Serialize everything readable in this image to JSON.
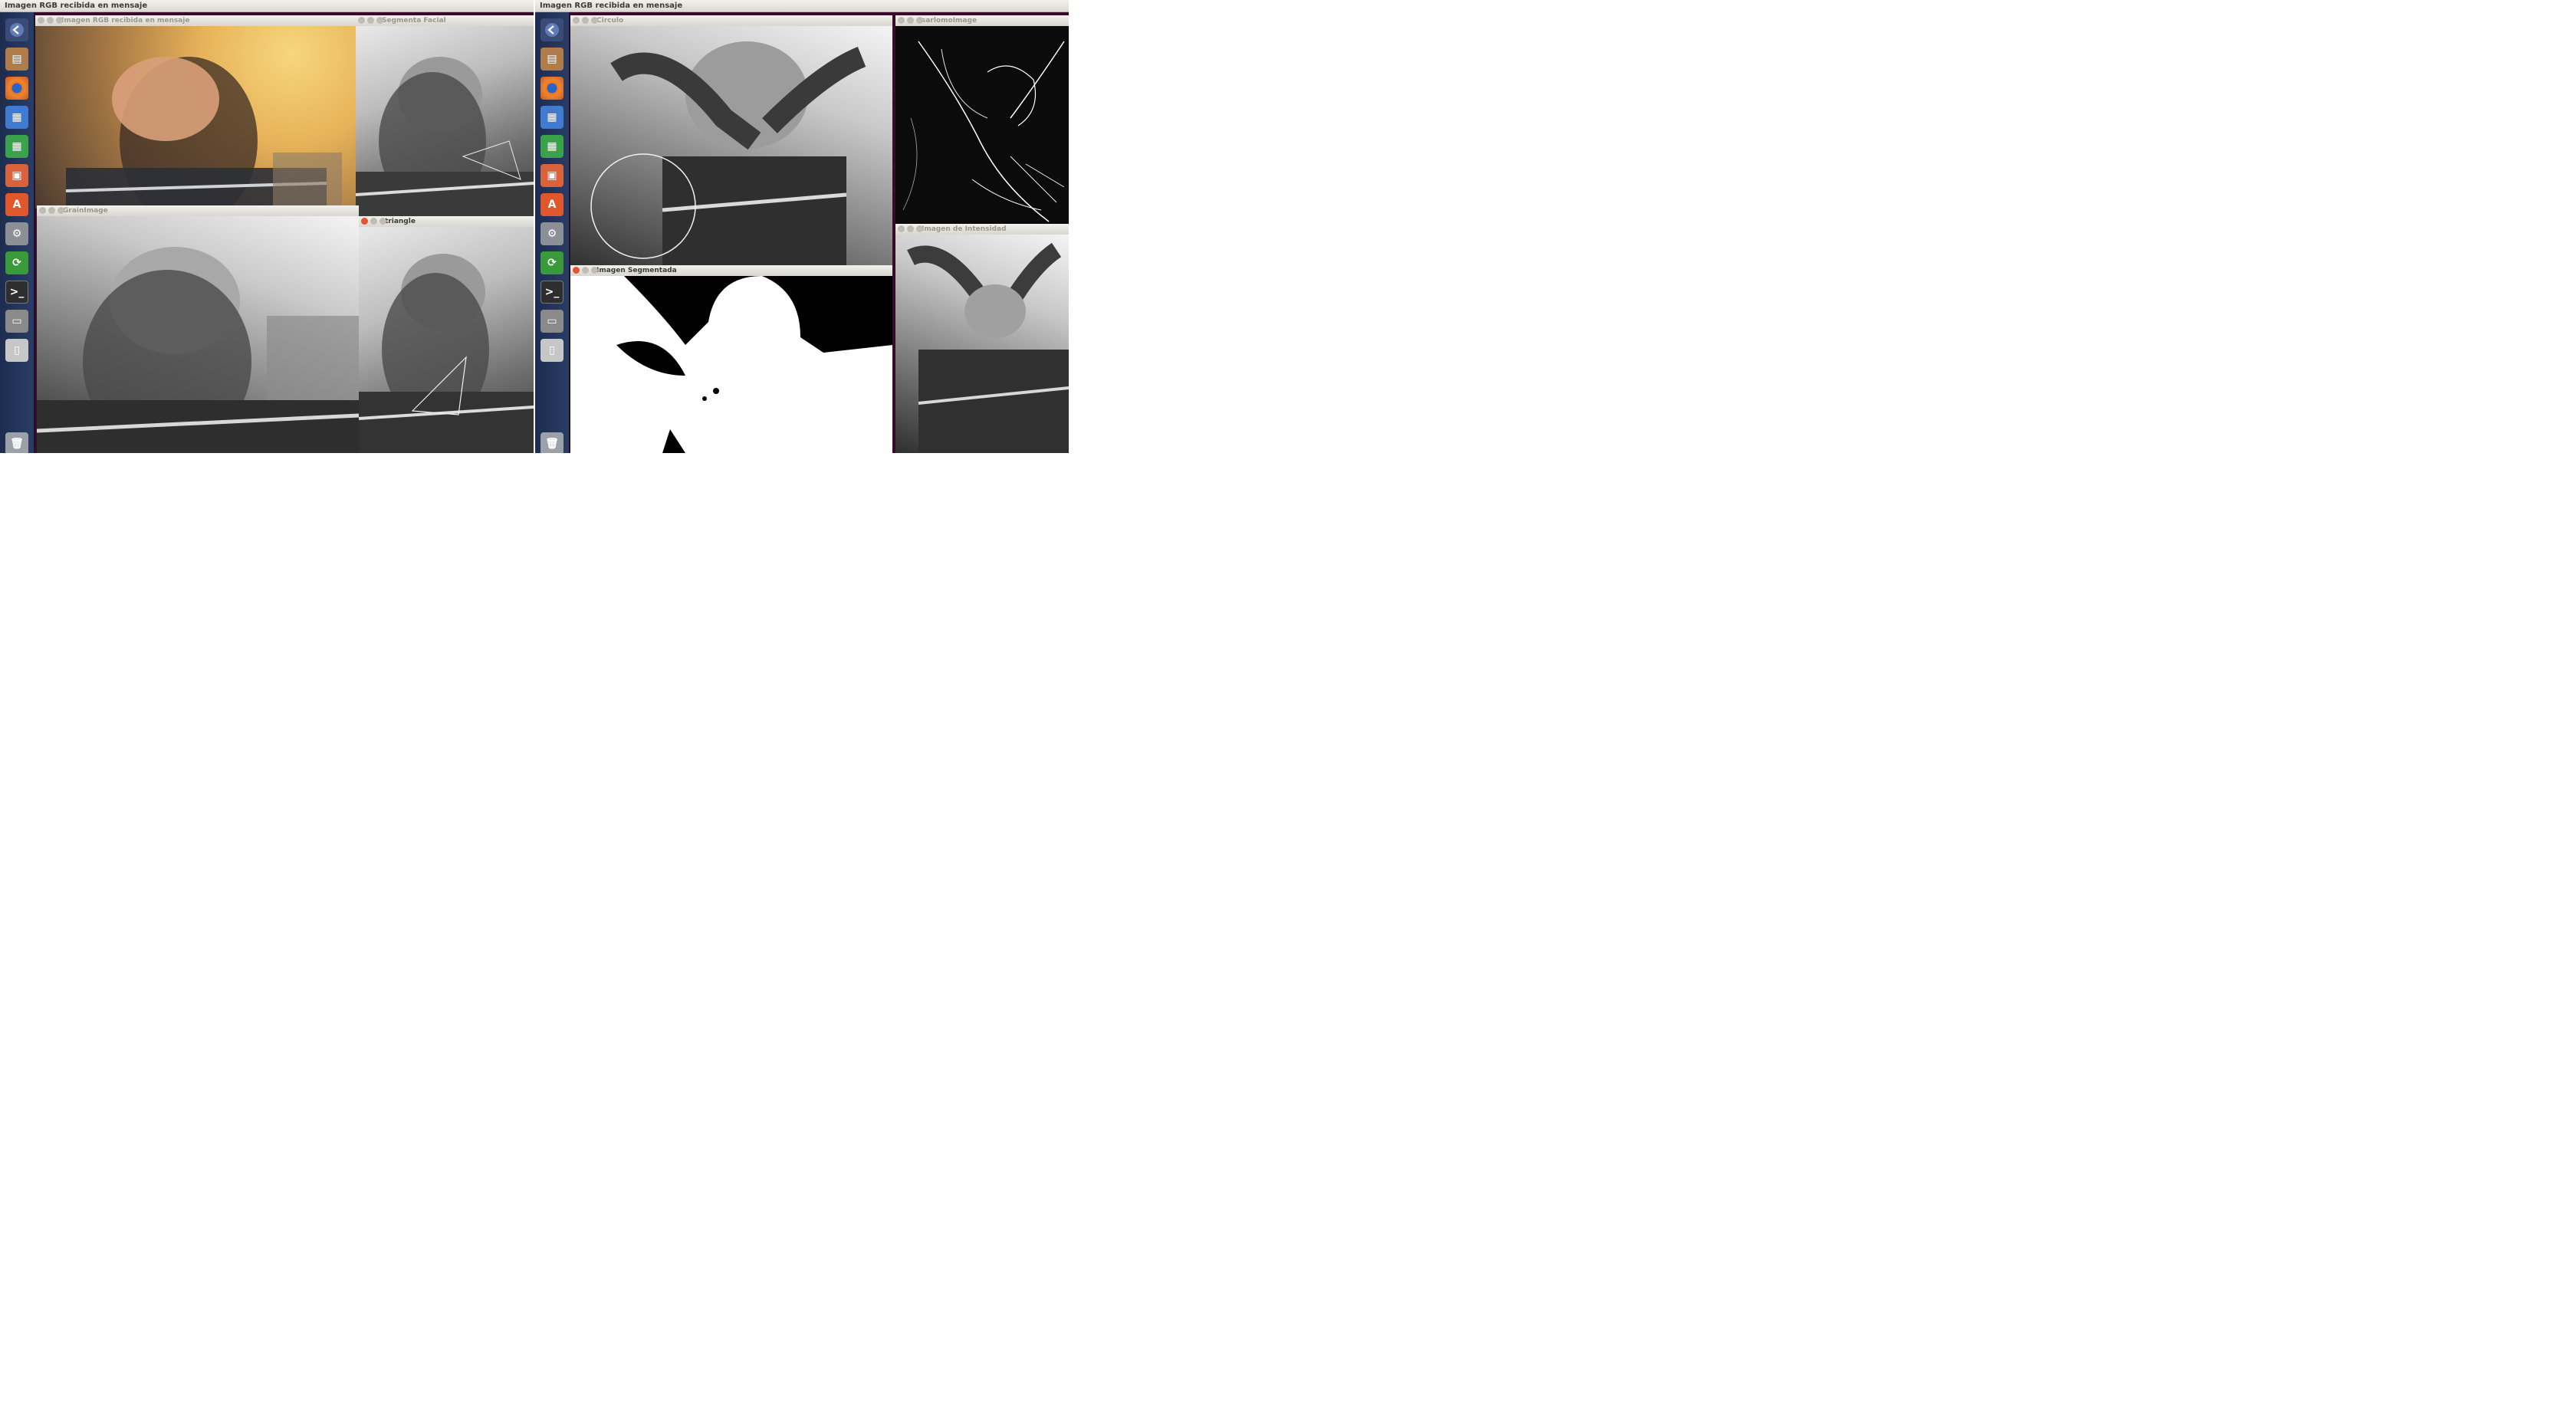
{
  "screens": [
    {
      "topbar_title": "Imagen RGB recibida en mensaje",
      "windows": {
        "rgb": "Imagen RGB recibida en mensaje",
        "segmentacion": "Segmenta Facial",
        "gray": "GrainImage",
        "triangle": "triangle"
      }
    },
    {
      "topbar_title": "Imagen RGB recibida en mensaje",
      "windows": {
        "circle": "Circulo",
        "edges": "sarlomoImage",
        "segmented": "Imagen Segmentada",
        "intensity": "Imagen de Intensidad"
      }
    }
  ],
  "launcher_icons": [
    "back-icon",
    "files-icon",
    "firefox-icon",
    "writer-icon",
    "calc-icon",
    "impress-icon",
    "software-center-icon",
    "settings-icon",
    "update-icon",
    "terminal-icon",
    "disk-icon",
    "usb-icon",
    "trash-icon"
  ],
  "colors": {
    "launcher": "#25365c",
    "titlebar": "#e7e4de",
    "close_button": "#e2552d",
    "desktop": "#3a0a2a"
  }
}
